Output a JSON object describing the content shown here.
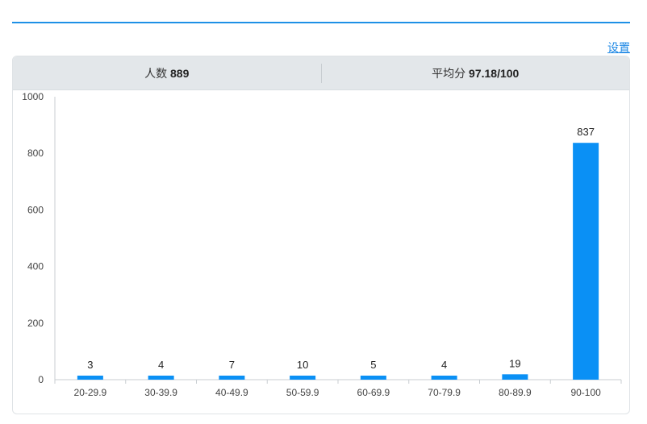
{
  "header": {
    "settings_label": "设置"
  },
  "stats": {
    "count_label": "人数",
    "count_value": "889",
    "average_label": "平均分",
    "average_value": "97.18/100"
  },
  "colors": {
    "bar": "#0a90f5",
    "accent": "#1e90e6"
  },
  "chart_data": {
    "type": "bar",
    "categories": [
      "20-29.9",
      "30-39.9",
      "40-49.9",
      "50-59.9",
      "60-69.9",
      "70-79.9",
      "80-89.9",
      "90-100"
    ],
    "values": [
      3,
      4,
      7,
      10,
      5,
      4,
      19,
      837
    ],
    "ylim": [
      0,
      1000
    ],
    "yticks": [
      0,
      200,
      400,
      600,
      800,
      1000
    ],
    "grid": false,
    "title": "",
    "xlabel": "",
    "ylabel": ""
  }
}
